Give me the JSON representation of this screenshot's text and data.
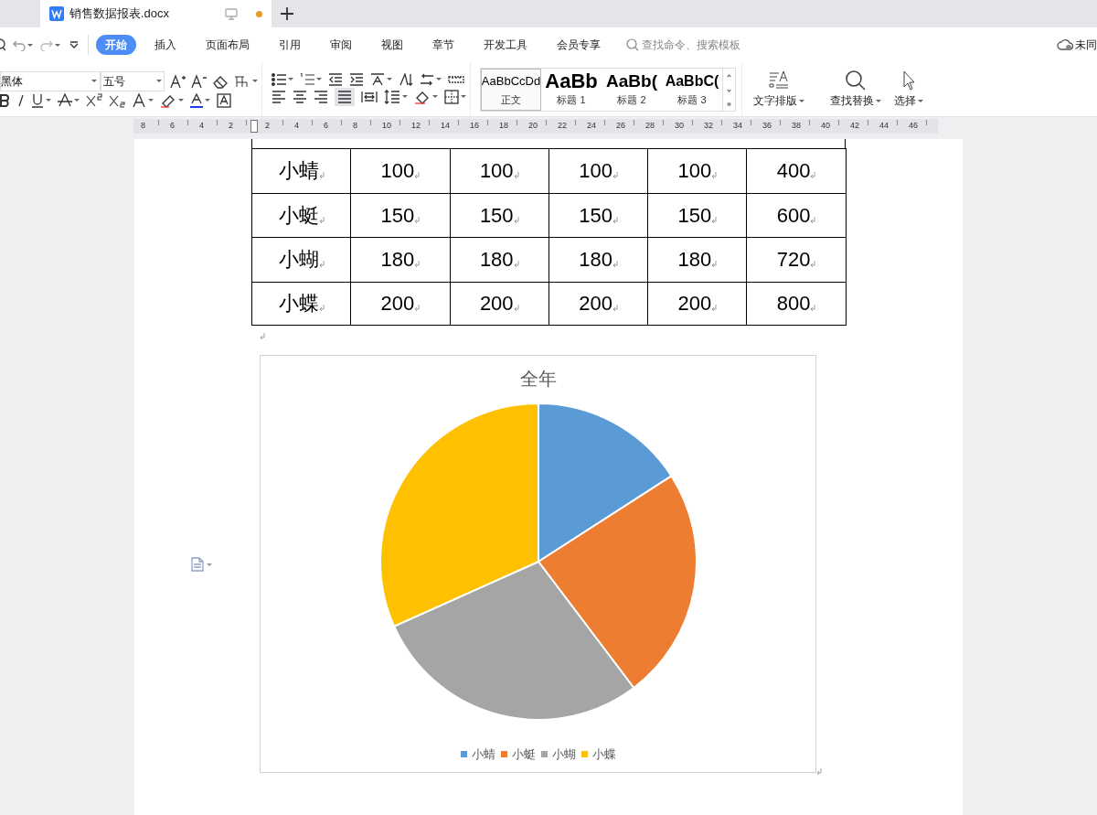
{
  "tabs": [
    {
      "title": "销售数据报表.docx",
      "selected": true,
      "unsaved": true
    }
  ],
  "menu": [
    {
      "label": "开始",
      "selected": true
    },
    {
      "label": "插入",
      "selected": false
    },
    {
      "label": "页面布局",
      "selected": false
    },
    {
      "label": "引用",
      "selected": false
    },
    {
      "label": "审阅",
      "selected": false
    },
    {
      "label": "视图",
      "selected": false
    },
    {
      "label": "章节",
      "selected": false
    },
    {
      "label": "开发工具",
      "selected": false
    },
    {
      "label": "会员专享",
      "selected": false
    }
  ],
  "search": {
    "placeholder": "查找命令、搜索模板"
  },
  "sync_status": "未同",
  "font": {
    "name": "黑体",
    "size": "五号"
  },
  "styles": [
    {
      "sample": "AaBbCcDd",
      "label": "正文",
      "kind": "normal",
      "selected": true
    },
    {
      "sample": "AaBb",
      "label": "标题 1",
      "kind": "h1",
      "selected": false
    },
    {
      "sample": "AaBb(",
      "label": "标题 2",
      "kind": "h2",
      "selected": false
    },
    {
      "sample": "AaBbC(",
      "label": "标题 3",
      "kind": "h3",
      "selected": false
    }
  ],
  "big_buttons": [
    "文字排版",
    "查找替换",
    "选择"
  ],
  "ruler": [
    "8",
    "6",
    "4",
    "2",
    "2",
    "4",
    "6",
    "8",
    "10",
    "12",
    "14",
    "16",
    "18",
    "20",
    "22",
    "24",
    "26",
    "28",
    "30",
    "32",
    "34",
    "36",
    "38",
    "40",
    "42",
    "44",
    "46"
  ],
  "table": {
    "rows": [
      [
        "小蜻",
        "100",
        "100",
        "100",
        "100",
        "400"
      ],
      [
        "小蜓",
        "150",
        "150",
        "150",
        "150",
        "600"
      ],
      [
        "小蝴",
        "180",
        "180",
        "180",
        "180",
        "720"
      ],
      [
        "小蝶",
        "200",
        "200",
        "200",
        "200",
        "800"
      ]
    ]
  },
  "chart_data": {
    "type": "pie",
    "title": "全年",
    "categories": [
      "小蜻",
      "小蜓",
      "小蝴",
      "小蝶"
    ],
    "values": [
      15.9,
      23.8,
      28.6,
      31.7
    ],
    "colors": [
      "#5b9bd5",
      "#ed7d31",
      "#a5a5a5",
      "#ffc000"
    ],
    "legend": "bottom"
  }
}
